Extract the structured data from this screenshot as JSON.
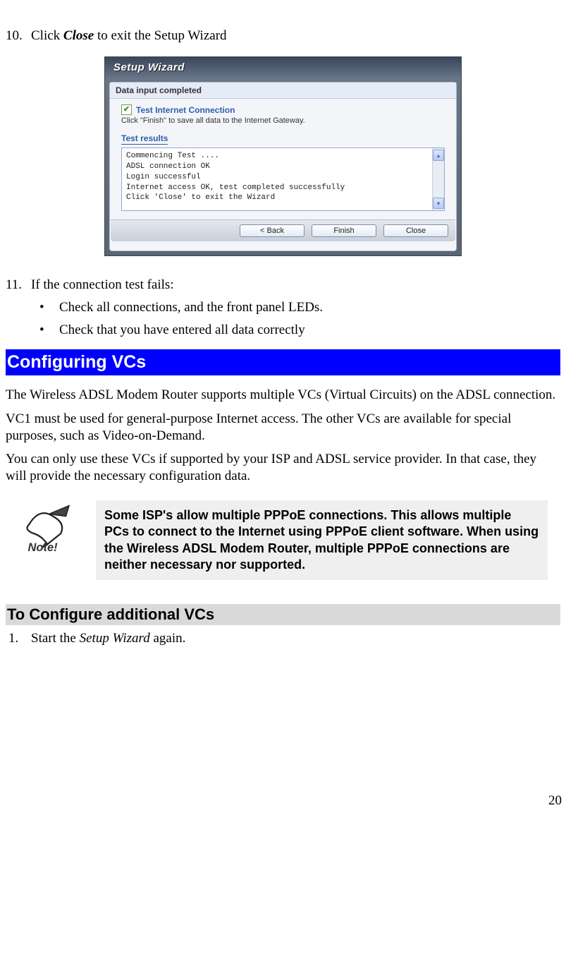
{
  "step10": {
    "num": "10.",
    "text_prefix": "Click ",
    "text_bold": "Close",
    "text_suffix": " to exit the Setup Wizard"
  },
  "wizard": {
    "title": "Setup Wizard",
    "status": "Data input completed",
    "checkbox_label": "Test Internet Connection",
    "hint": "Click \"Finish\" to save all data to the Internet Gateway.",
    "results_label": "Test results",
    "results_text": "Commencing Test ....\nADSL connection OK\nLogin successful\nInternet access OK, test completed successfully\nClick 'Close' to exit the Wizard",
    "buttons": {
      "back": "< Back",
      "finish": "Finish",
      "close": "Close"
    }
  },
  "step11": {
    "num": "11.",
    "text": "If the connection test fails:",
    "bullets": [
      "Check all connections, and the front panel LEDs.",
      "Check that you have entered all data correctly"
    ]
  },
  "section_heading": "Configuring VCs",
  "paragraphs": [
    "The Wireless ADSL Modem Router supports multiple VCs (Virtual Circuits) on the ADSL connection.",
    "VC1 must be used for general-purpose Internet access. The other VCs are available for special purposes, such as Video-on-Demand.",
    "You can only use these VCs if supported by your ISP and ADSL service provider. In that case, they will provide the necessary configuration data."
  ],
  "note_text": "Some ISP's allow multiple PPPoE connections. This allows multiple PCs to connect to the Internet using PPPoE client software. When using the Wireless ADSL Modem Router, multiple PPPoE connections are neither necessary nor supported.",
  "grey_heading": "To Configure additional VCs",
  "step1": {
    "num": "1.",
    "text_prefix": "Start the ",
    "text_italic": "Setup Wizard",
    "text_suffix": " again."
  },
  "page_number": "20"
}
